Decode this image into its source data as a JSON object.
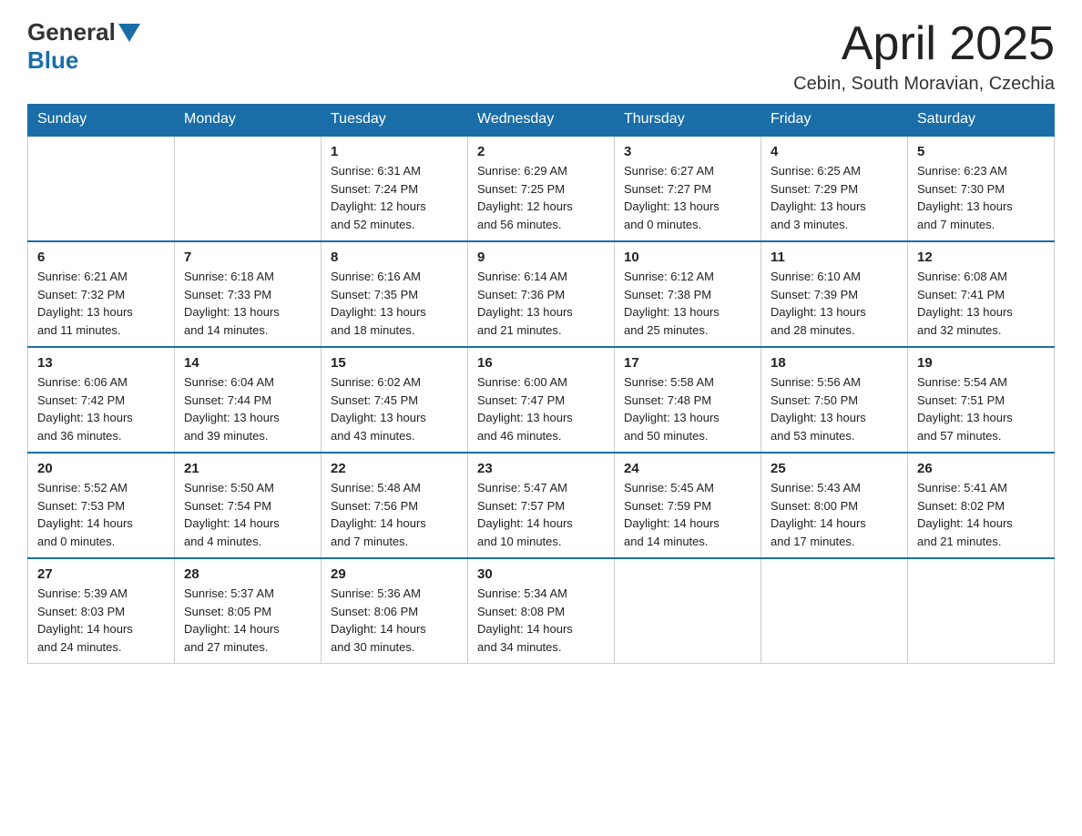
{
  "logo": {
    "general": "General",
    "blue": "Blue"
  },
  "header": {
    "month_title": "April 2025",
    "location": "Cebin, South Moravian, Czechia"
  },
  "weekdays": [
    "Sunday",
    "Monday",
    "Tuesday",
    "Wednesday",
    "Thursday",
    "Friday",
    "Saturday"
  ],
  "weeks": [
    [
      {
        "day": "",
        "info": ""
      },
      {
        "day": "",
        "info": ""
      },
      {
        "day": "1",
        "info": "Sunrise: 6:31 AM\nSunset: 7:24 PM\nDaylight: 12 hours\nand 52 minutes."
      },
      {
        "day": "2",
        "info": "Sunrise: 6:29 AM\nSunset: 7:25 PM\nDaylight: 12 hours\nand 56 minutes."
      },
      {
        "day": "3",
        "info": "Sunrise: 6:27 AM\nSunset: 7:27 PM\nDaylight: 13 hours\nand 0 minutes."
      },
      {
        "day": "4",
        "info": "Sunrise: 6:25 AM\nSunset: 7:29 PM\nDaylight: 13 hours\nand 3 minutes."
      },
      {
        "day": "5",
        "info": "Sunrise: 6:23 AM\nSunset: 7:30 PM\nDaylight: 13 hours\nand 7 minutes."
      }
    ],
    [
      {
        "day": "6",
        "info": "Sunrise: 6:21 AM\nSunset: 7:32 PM\nDaylight: 13 hours\nand 11 minutes."
      },
      {
        "day": "7",
        "info": "Sunrise: 6:18 AM\nSunset: 7:33 PM\nDaylight: 13 hours\nand 14 minutes."
      },
      {
        "day": "8",
        "info": "Sunrise: 6:16 AM\nSunset: 7:35 PM\nDaylight: 13 hours\nand 18 minutes."
      },
      {
        "day": "9",
        "info": "Sunrise: 6:14 AM\nSunset: 7:36 PM\nDaylight: 13 hours\nand 21 minutes."
      },
      {
        "day": "10",
        "info": "Sunrise: 6:12 AM\nSunset: 7:38 PM\nDaylight: 13 hours\nand 25 minutes."
      },
      {
        "day": "11",
        "info": "Sunrise: 6:10 AM\nSunset: 7:39 PM\nDaylight: 13 hours\nand 28 minutes."
      },
      {
        "day": "12",
        "info": "Sunrise: 6:08 AM\nSunset: 7:41 PM\nDaylight: 13 hours\nand 32 minutes."
      }
    ],
    [
      {
        "day": "13",
        "info": "Sunrise: 6:06 AM\nSunset: 7:42 PM\nDaylight: 13 hours\nand 36 minutes."
      },
      {
        "day": "14",
        "info": "Sunrise: 6:04 AM\nSunset: 7:44 PM\nDaylight: 13 hours\nand 39 minutes."
      },
      {
        "day": "15",
        "info": "Sunrise: 6:02 AM\nSunset: 7:45 PM\nDaylight: 13 hours\nand 43 minutes."
      },
      {
        "day": "16",
        "info": "Sunrise: 6:00 AM\nSunset: 7:47 PM\nDaylight: 13 hours\nand 46 minutes."
      },
      {
        "day": "17",
        "info": "Sunrise: 5:58 AM\nSunset: 7:48 PM\nDaylight: 13 hours\nand 50 minutes."
      },
      {
        "day": "18",
        "info": "Sunrise: 5:56 AM\nSunset: 7:50 PM\nDaylight: 13 hours\nand 53 minutes."
      },
      {
        "day": "19",
        "info": "Sunrise: 5:54 AM\nSunset: 7:51 PM\nDaylight: 13 hours\nand 57 minutes."
      }
    ],
    [
      {
        "day": "20",
        "info": "Sunrise: 5:52 AM\nSunset: 7:53 PM\nDaylight: 14 hours\nand 0 minutes."
      },
      {
        "day": "21",
        "info": "Sunrise: 5:50 AM\nSunset: 7:54 PM\nDaylight: 14 hours\nand 4 minutes."
      },
      {
        "day": "22",
        "info": "Sunrise: 5:48 AM\nSunset: 7:56 PM\nDaylight: 14 hours\nand 7 minutes."
      },
      {
        "day": "23",
        "info": "Sunrise: 5:47 AM\nSunset: 7:57 PM\nDaylight: 14 hours\nand 10 minutes."
      },
      {
        "day": "24",
        "info": "Sunrise: 5:45 AM\nSunset: 7:59 PM\nDaylight: 14 hours\nand 14 minutes."
      },
      {
        "day": "25",
        "info": "Sunrise: 5:43 AM\nSunset: 8:00 PM\nDaylight: 14 hours\nand 17 minutes."
      },
      {
        "day": "26",
        "info": "Sunrise: 5:41 AM\nSunset: 8:02 PM\nDaylight: 14 hours\nand 21 minutes."
      }
    ],
    [
      {
        "day": "27",
        "info": "Sunrise: 5:39 AM\nSunset: 8:03 PM\nDaylight: 14 hours\nand 24 minutes."
      },
      {
        "day": "28",
        "info": "Sunrise: 5:37 AM\nSunset: 8:05 PM\nDaylight: 14 hours\nand 27 minutes."
      },
      {
        "day": "29",
        "info": "Sunrise: 5:36 AM\nSunset: 8:06 PM\nDaylight: 14 hours\nand 30 minutes."
      },
      {
        "day": "30",
        "info": "Sunrise: 5:34 AM\nSunset: 8:08 PM\nDaylight: 14 hours\nand 34 minutes."
      },
      {
        "day": "",
        "info": ""
      },
      {
        "day": "",
        "info": ""
      },
      {
        "day": "",
        "info": ""
      }
    ]
  ]
}
